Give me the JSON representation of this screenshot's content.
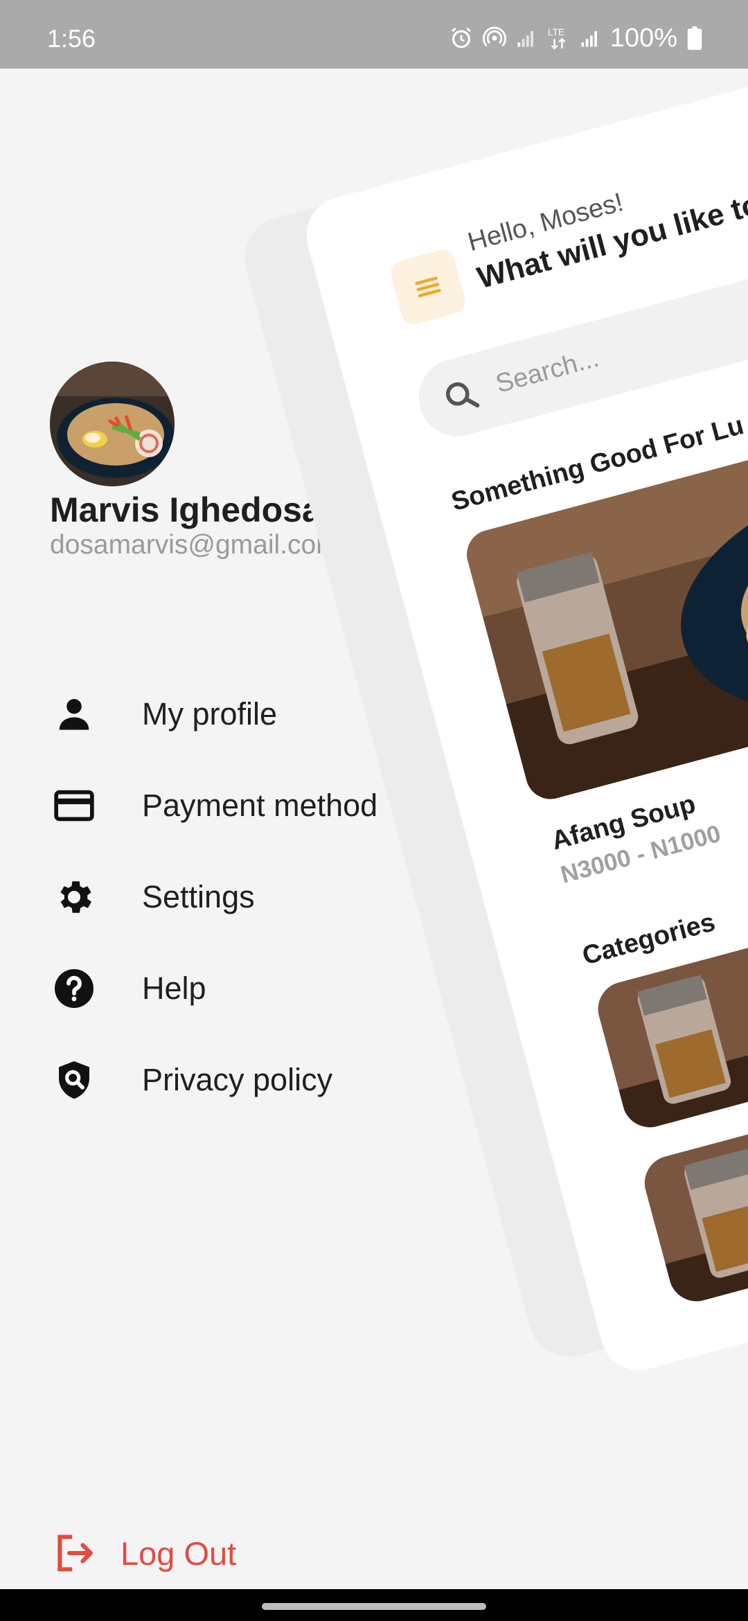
{
  "status_bar": {
    "time": "1:56",
    "battery_text": "100%",
    "network_label": "LTE",
    "icons": [
      "alarm-icon",
      "hotspot-icon",
      "signal-icon",
      "lte-icon",
      "signal-icon",
      "battery-icon"
    ]
  },
  "drawer": {
    "user": {
      "name": "Marvis Ighedosa",
      "email": "dosamarvis@gmail.com"
    },
    "menu_items": [
      {
        "label": "My profile",
        "icon": "person-icon"
      },
      {
        "label": "Payment method",
        "icon": "credit-card-icon"
      },
      {
        "label": "Settings",
        "icon": "gear-icon"
      },
      {
        "label": "Help",
        "icon": "help-icon"
      },
      {
        "label": "Privacy policy",
        "icon": "privacy-shield-icon"
      }
    ],
    "logout_label": "Log Out"
  },
  "home": {
    "greeting": "Hello, Moses!",
    "prompt": "What will you like to",
    "search_placeholder": "Search...",
    "featured_title": "Something Good For Lu",
    "featured_item": {
      "name": "Afang Soup",
      "price": "N3000 - N1000"
    },
    "categories_title": "Categories"
  },
  "colors": {
    "accent": "#f5a623",
    "menu_button_bg": "#fdf1df",
    "logout": "#e34b3f",
    "status_bar": "#aaaaaa",
    "background": "#f4f4f4"
  }
}
